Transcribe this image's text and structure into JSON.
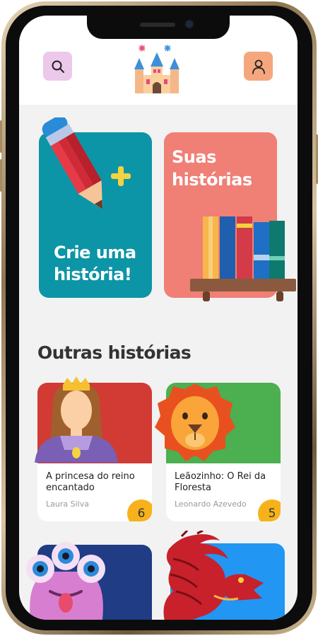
{
  "header": {
    "search_icon": "search-icon",
    "logo_icon": "castle-icon",
    "profile_icon": "user-icon"
  },
  "cards": {
    "create": {
      "title_line1": "Crie uma",
      "title_line2": "história!",
      "color": "#0c95a7"
    },
    "yours": {
      "title_line1": "Suas",
      "title_line2": "histórias",
      "color": "#f07f76"
    }
  },
  "section": {
    "title": "Outras histórias"
  },
  "stories": [
    {
      "title": "A princesa do reino encantado",
      "author": "Laura Silva",
      "count": "6",
      "image_icon": "princess-icon",
      "color": "#d13b34"
    },
    {
      "title": "Leãozinho: O Rei da Floresta",
      "author": "Leonardo Azevedo",
      "count": "5",
      "image_icon": "lion-icon",
      "color": "#4caf50"
    },
    {
      "title": "",
      "author": "",
      "count": "",
      "image_icon": "monster-icon",
      "color": "#1f3c85"
    },
    {
      "title": "",
      "author": "",
      "count": "",
      "image_icon": "dragon-icon",
      "color": "#2196f3"
    }
  ],
  "colors": {
    "accent": "#f7b21b",
    "background": "#f2f2f2"
  }
}
